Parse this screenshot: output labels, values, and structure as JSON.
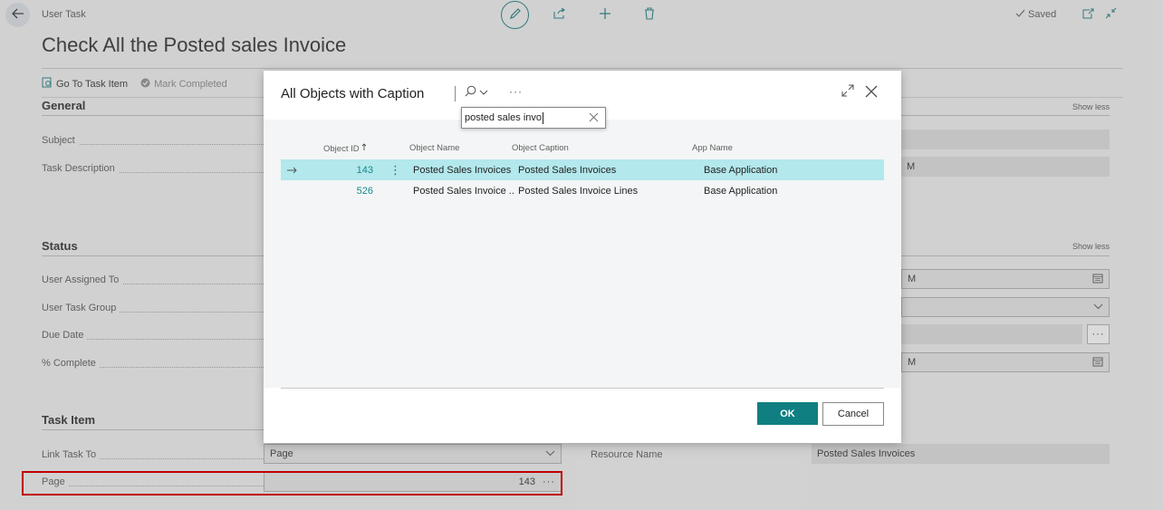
{
  "header": {
    "breadcrumb": "User Task",
    "title": "Check All the Posted sales Invoice",
    "saved_label": "Saved"
  },
  "actions": {
    "go_to_task_item": "Go To Task Item",
    "mark_completed": "Mark Completed"
  },
  "sections": {
    "general": {
      "title": "General",
      "show_less": "Show less",
      "fields": {
        "subject": "Subject",
        "task_description": "Task Description"
      }
    },
    "status": {
      "title": "Status",
      "show_less": "Show less",
      "fields": {
        "user_assigned_to": "User Assigned To",
        "user_task_group": "User Task Group",
        "due_date": "Due Date",
        "percent_complete": "% Complete"
      },
      "right_values": {
        "r1": "M",
        "r4": "M"
      }
    },
    "task_item": {
      "title": "Task Item",
      "fields": {
        "link_task_to": "Link Task To",
        "link_task_to_value": "Page",
        "page": "Page",
        "page_value": "143",
        "resource_name": "Resource Name",
        "resource_name_value": "Posted Sales Invoices"
      }
    },
    "general_right_value": "M"
  },
  "dialog": {
    "title": "All Objects with Caption",
    "search_value": "posted sales invo",
    "columns": {
      "object_id": "Object ID",
      "object_name": "Object Name",
      "object_caption": "Object Caption",
      "app_name": "App Name"
    },
    "rows": [
      {
        "object_id": "143",
        "object_name": "Posted Sales Invoices",
        "object_caption": "Posted Sales Invoices",
        "app_name": "Base Application"
      },
      {
        "object_id": "526",
        "object_name": "Posted Sales Invoice ...",
        "object_caption": "Posted Sales Invoice Lines",
        "app_name": "Base Application"
      }
    ],
    "ok_label": "OK",
    "cancel_label": "Cancel"
  },
  "icons": [
    "back-arrow-icon",
    "pencil-icon",
    "share-icon",
    "plus-icon",
    "trash-icon",
    "checkmark-icon",
    "open-new-window-icon",
    "collapse-icon",
    "search-icon",
    "chevron-down-icon",
    "more-icon",
    "expand-icon",
    "close-icon",
    "clear-icon",
    "row-arrow-icon",
    "calendar-icon",
    "sort-up-icon"
  ],
  "colors": {
    "accent": "#0f7f82",
    "selected_row": "#b3e8ec",
    "highlight_box": "#e00000"
  }
}
